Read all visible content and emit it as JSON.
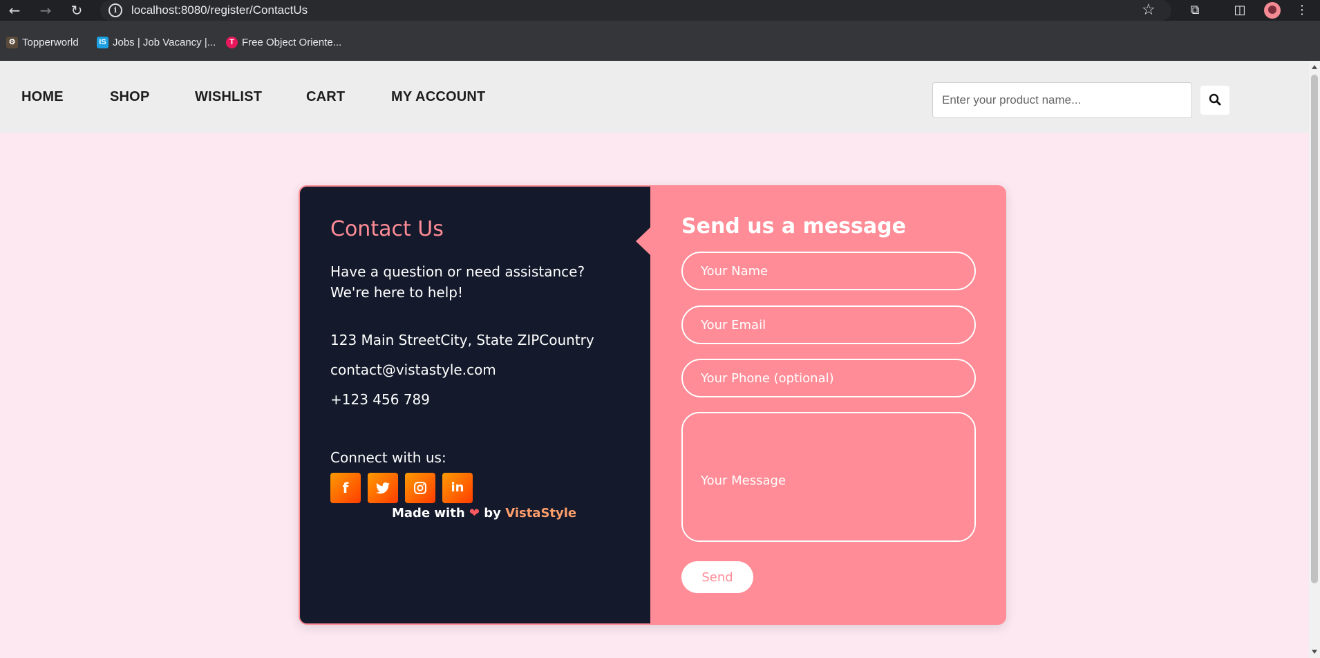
{
  "browser": {
    "url": "localhost:8080/register/ContactUs",
    "bookmarks": [
      {
        "label": "Topperworld",
        "icon": "topperworld-icon"
      },
      {
        "label": "Jobs | Job Vacancy |...",
        "icon": "is-icon"
      },
      {
        "label": "Free Object Oriente...",
        "icon": "t-icon"
      }
    ]
  },
  "nav": {
    "items": [
      "HOME",
      "SHOP",
      "WISHLIST",
      "CART",
      "MY ACCOUNT"
    ],
    "search_placeholder": "Enter your product name..."
  },
  "contact": {
    "title": "Contact Us",
    "intro": "Have a question or need assistance? We're here to help!",
    "address": "123 Main StreetCity, State ZIPCountry",
    "email": "contact@vistastyle.com",
    "phone": "+123 456 789",
    "connect_label": "Connect with us:",
    "socials": [
      "facebook-icon",
      "twitter-icon",
      "instagram-icon",
      "linkedin-icon"
    ],
    "made_with_prefix": "Made with",
    "made_with_by": "by",
    "brand": "VistaStyle"
  },
  "form": {
    "title": "Send us a message",
    "name_placeholder": "Your Name",
    "email_placeholder": "Your Email",
    "phone_placeholder": "Your Phone (optional)",
    "message_placeholder": "Your Message",
    "send_label": "Send"
  },
  "colors": {
    "accent": "#ff8c96",
    "dark_panel": "#141a2c",
    "page_bg": "#fde8f1"
  }
}
